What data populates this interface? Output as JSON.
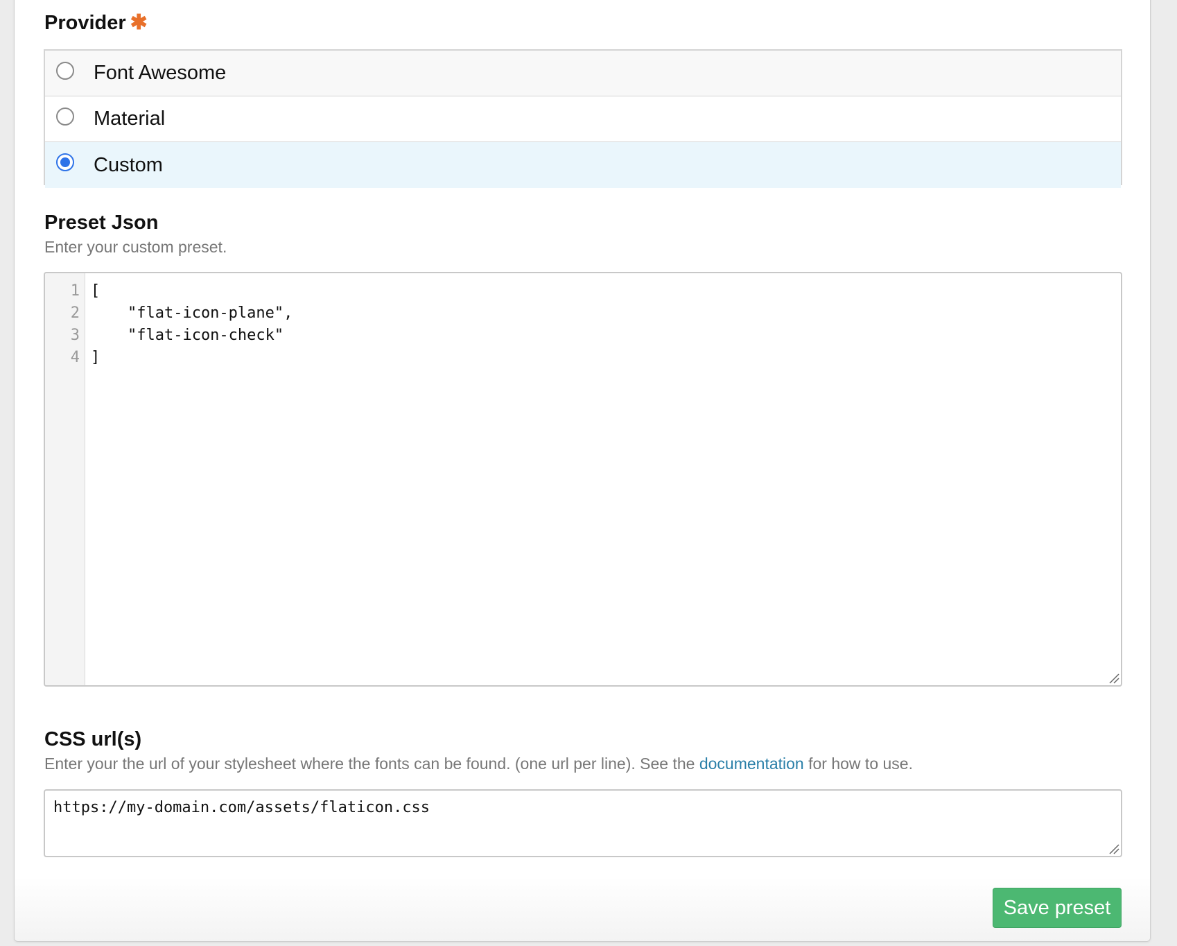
{
  "provider": {
    "label": "Provider",
    "required_mark": "✱",
    "options": [
      {
        "label": "Font Awesome",
        "checked": false
      },
      {
        "label": "Material",
        "checked": false
      },
      {
        "label": "Custom",
        "checked": true
      }
    ],
    "checked_bg": "#eaf6fc",
    "alt_bg": "#f8f8f8"
  },
  "preset_json": {
    "label": "Preset Json",
    "help": "Enter your custom preset.",
    "lines": [
      {
        "num": "1",
        "code": "["
      },
      {
        "num": "2",
        "code": "    \"flat-icon-plane\","
      },
      {
        "num": "3",
        "code": "    \"flat-icon-check\""
      },
      {
        "num": "4",
        "code": "]"
      }
    ]
  },
  "css_urls": {
    "label": "CSS url(s)",
    "help_before": "Enter your the url of your stylesheet where the fonts can be found. (one url per line). See the ",
    "help_link": "documentation",
    "help_after": " for how to use.",
    "value": "https://my-domain.com/assets/flaticon.css"
  },
  "actions": {
    "save_label": "Save preset"
  },
  "colors": {
    "accent": "#2e73e8",
    "required": "#e8702a",
    "link": "#2a7fa8",
    "save_button": "#4cb872"
  }
}
